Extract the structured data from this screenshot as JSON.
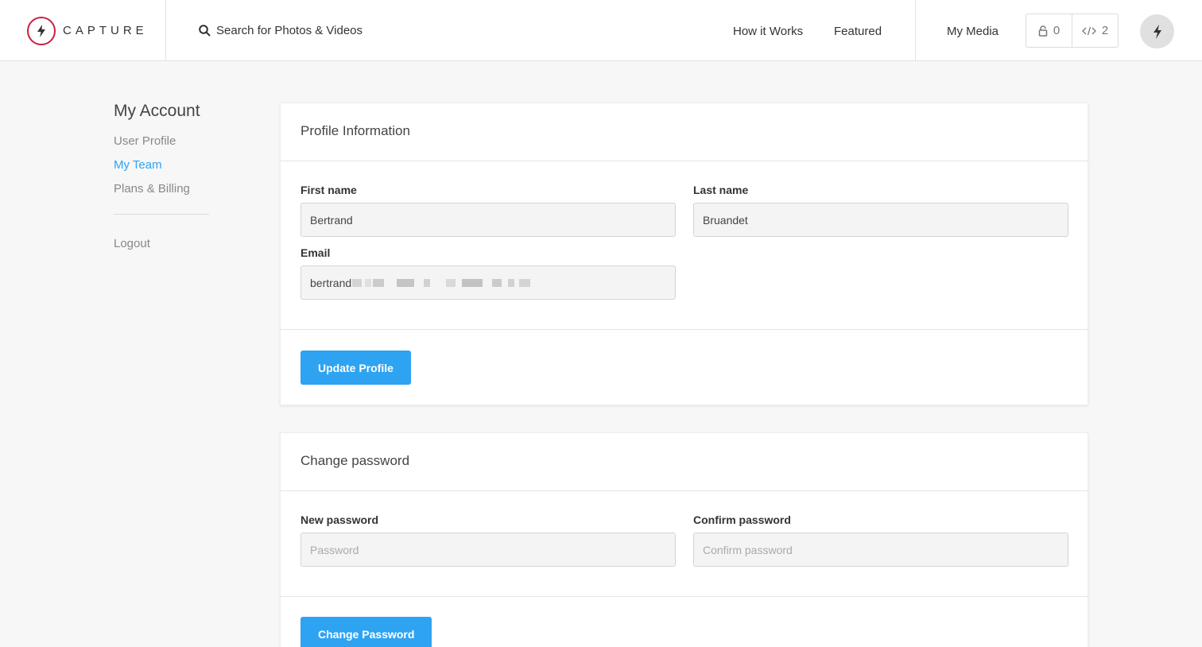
{
  "header": {
    "logo_text": "CAPTURE",
    "search_label": "Search for Photos & Videos",
    "nav": {
      "how_it_works": "How it Works",
      "featured": "Featured",
      "my_media": "My Media"
    },
    "counters": {
      "private_count": "0",
      "embed_count": "2"
    }
  },
  "sidebar": {
    "title": "My Account",
    "items": [
      {
        "label": "User Profile",
        "active": false
      },
      {
        "label": "My Team",
        "active": true
      },
      {
        "label": "Plans & Billing",
        "active": false
      }
    ],
    "logout": "Logout"
  },
  "profile": {
    "heading": "Profile Information",
    "first_name_label": "First name",
    "first_name_value": "Bertrand",
    "last_name_label": "Last name",
    "last_name_value": "Bruandet",
    "email_label": "Email",
    "email_value": "bertrand",
    "update_button": "Update Profile"
  },
  "password": {
    "heading": "Change password",
    "new_label": "New password",
    "new_placeholder": "Password",
    "confirm_label": "Confirm password",
    "confirm_placeholder": "Confirm password",
    "change_button": "Change Password"
  },
  "colors": {
    "accent": "#2ea3f2",
    "brand": "#c8203f",
    "page_bg": "#f7f7f7"
  }
}
